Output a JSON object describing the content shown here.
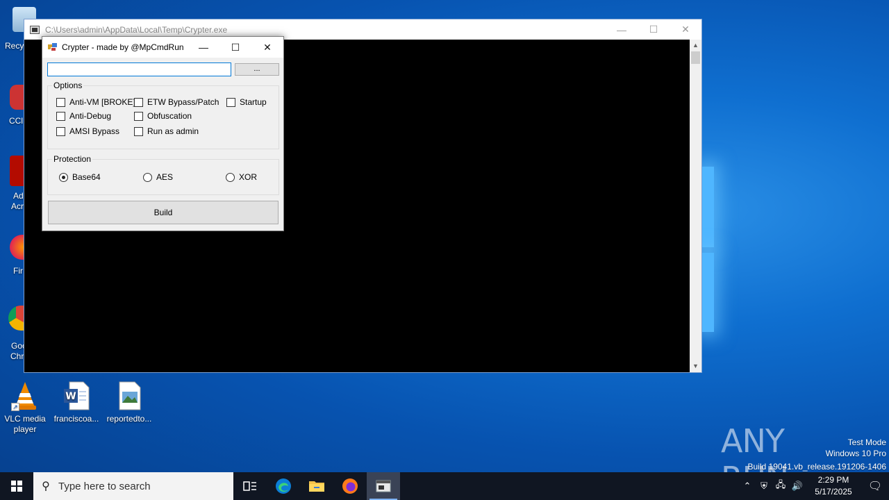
{
  "desktop": {
    "icons": [
      {
        "label": "VLC media player"
      },
      {
        "label": "franciscoa..."
      },
      {
        "label": "reportedto..."
      }
    ],
    "partial_labels": [
      "Recy",
      "[+]",
      "CCl",
      "Ad",
      "Acr",
      "Fir",
      "Goo",
      "Chr"
    ]
  },
  "console": {
    "title": "C:\\Users\\admin\\AppData\\Local\\Temp\\Crypter.exe",
    "minimize": "—",
    "maximize": "☐",
    "close": "✕"
  },
  "dialog": {
    "title": "Crypter - made by @MpCmdRun",
    "minimize": "—",
    "maximize": "☐",
    "close": "✕",
    "path_value": "",
    "browse_label": "...",
    "options": {
      "title": "Options",
      "items": [
        {
          "label": "Anti-VM [BROKE]",
          "checked": false
        },
        {
          "label": "ETW Bypass/Patch",
          "checked": false
        },
        {
          "label": "Startup",
          "checked": false
        },
        {
          "label": "Anti-Debug",
          "checked": false
        },
        {
          "label": "Obfuscation",
          "checked": false
        },
        {
          "label": "AMSI Bypass",
          "checked": false
        },
        {
          "label": "Run as admin",
          "checked": false
        }
      ]
    },
    "protection": {
      "title": "Protection",
      "items": [
        {
          "label": "Base64",
          "selected": true
        },
        {
          "label": "AES",
          "selected": false
        },
        {
          "label": "XOR",
          "selected": false
        }
      ]
    },
    "build_label": "Build"
  },
  "watermark": {
    "brand": "ANY RUN",
    "line1": "Test Mode",
    "line2": "Windows 10 Pro",
    "line3": "Build 19041.vb_release.191206-1406"
  },
  "taskbar": {
    "search_placeholder": "Type here to search",
    "time": "2:29 PM",
    "date": "5/17/2025"
  }
}
